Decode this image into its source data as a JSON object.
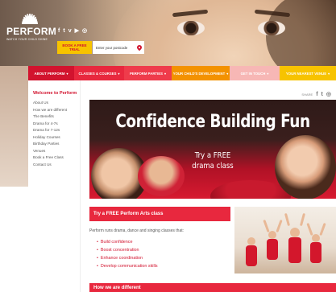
{
  "brand": {
    "name": "PERFORM",
    "tagline": "WATCH YOUR CHILD SHINE"
  },
  "header": {
    "social": [
      "f",
      "t",
      "v",
      "▶",
      "◎"
    ],
    "trial_button": "BOOK A FREE TRIAL",
    "postcode_placeholder": "Enter your postcode"
  },
  "nav": {
    "items": [
      {
        "label": "ABOUT PERFORM",
        "color": "#d2132e"
      },
      {
        "label": "CLASSES & COURSES",
        "color": "#e8283e"
      },
      {
        "label": "PERFORM PARTIES",
        "color": "#ef3b4b"
      },
      {
        "label": "YOUR CHILD'S DEVELOPMENT",
        "color": "#f39200"
      },
      {
        "label": "GET IN TOUCH",
        "color": "#f7b7b5"
      },
      {
        "label": "YOUR NEAREST VENUE",
        "color": "#f7c300"
      }
    ]
  },
  "sidebar": {
    "title": "Welcome to Perform",
    "items": [
      "About Us",
      "How we are different",
      "The Benefits",
      "Drama for 4-7s",
      "Drama for 7-12s",
      "Holiday Courses",
      "Birthday Parties",
      "Venues",
      "Book a Free Class",
      "Contact Us"
    ]
  },
  "share": {
    "label": "SHARE",
    "icons": [
      "f",
      "t",
      "◎"
    ]
  },
  "banner": {
    "title": "Confidence Building Fun",
    "line1": "Try a FREE",
    "line2": "drama class"
  },
  "cta": {
    "title": "Try a FREE Perform Arts class"
  },
  "intro": "Perform runs drama, dance and singing classes that:",
  "bullets": [
    "Build confidence",
    "Boost concentration",
    "Enhance coordination",
    "Develop communication skills"
  ],
  "section": {
    "title": "How we are different"
  },
  "colors": {
    "accent_red": "#d2132e",
    "yellow": "#f7c300",
    "orange": "#f39200"
  }
}
